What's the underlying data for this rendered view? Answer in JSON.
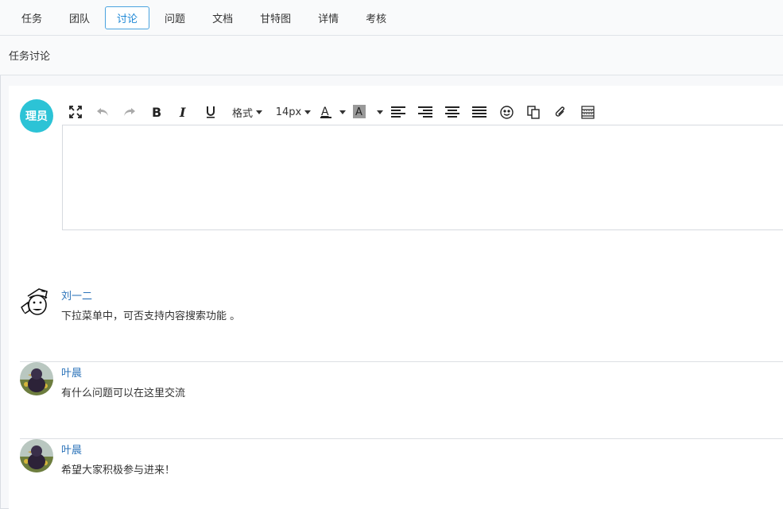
{
  "tabs": [
    {
      "label": "任务",
      "active": false
    },
    {
      "label": "团队",
      "active": false
    },
    {
      "label": "讨论",
      "active": true
    },
    {
      "label": "问题",
      "active": false
    },
    {
      "label": "文档",
      "active": false
    },
    {
      "label": "甘特图",
      "active": false
    },
    {
      "label": "详情",
      "active": false
    },
    {
      "label": "考核",
      "active": false
    }
  ],
  "section_title": "任务讨论",
  "current_user": {
    "avatar_text": "理员",
    "avatar_color": "#2cc3d6"
  },
  "toolbar": {
    "format_label": "格式",
    "font_size": "14px",
    "icons": [
      "fullscreen-icon",
      "undo-icon",
      "redo-icon",
      "bold-icon",
      "italic-icon",
      "underline-icon",
      "font-color-icon",
      "highlight-color-icon",
      "align-left-icon",
      "align-right-icon",
      "align-center-icon",
      "align-justify-icon",
      "emoji-icon",
      "copy-format-icon",
      "attachment-icon",
      "table-icon"
    ]
  },
  "editor": {
    "content": ""
  },
  "comments": [
    {
      "author": "刘一二",
      "text": "下拉菜单中，可否支持内容搜索功能 。",
      "avatar": "cartoon-man-icon"
    },
    {
      "author": "叶晨",
      "text": "有什么问题可以在这里交流",
      "avatar": "bird-photo-icon"
    },
    {
      "author": "叶晨",
      "text": "希望大家积极参与进来！",
      "avatar": "bird-photo-icon"
    }
  ],
  "colors": {
    "accent": "#1e88d6",
    "link": "#2b73b9"
  }
}
